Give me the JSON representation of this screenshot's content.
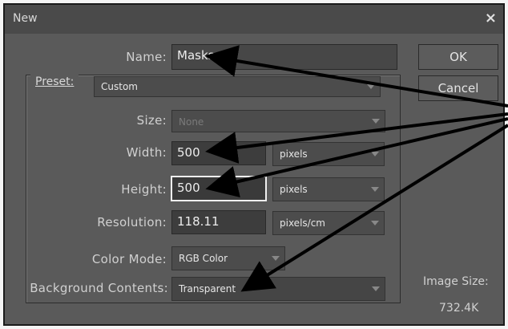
{
  "window": {
    "title": "New",
    "close_glyph": "×"
  },
  "name": {
    "label": "Name:",
    "value": "Masks"
  },
  "preset": {
    "label": "Preset:",
    "value": "Custom"
  },
  "size": {
    "label": "Size:",
    "value": "None"
  },
  "width": {
    "label": "Width:",
    "value": "500",
    "unit": "pixels"
  },
  "height": {
    "label": "Height:",
    "value": "500",
    "unit": "pixels"
  },
  "resolution": {
    "label": "Resolution:",
    "value": "118.11",
    "unit": "pixels/cm"
  },
  "color_mode": {
    "label": "Color Mode:",
    "value": "RGB Color"
  },
  "background": {
    "label": "Background Contents:",
    "value": "Transparent"
  },
  "buttons": {
    "ok": "OK",
    "cancel": "Cancel"
  },
  "image_size": {
    "label": "Image Size:",
    "value": "732.4K"
  },
  "annotation": {
    "arrow_color": "#000000"
  }
}
